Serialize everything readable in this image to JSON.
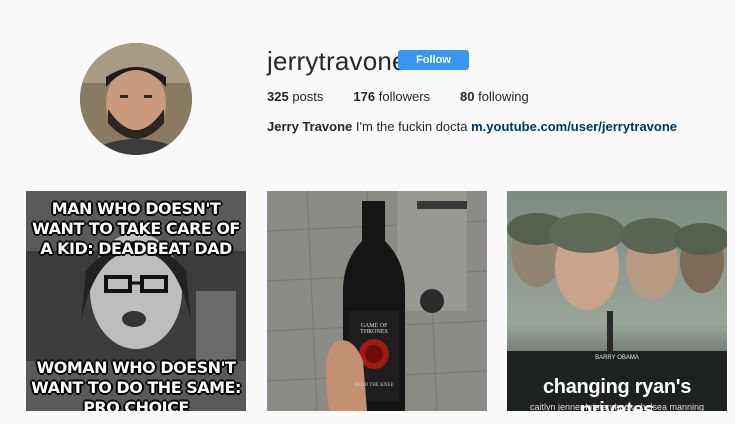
{
  "profile": {
    "username": "jerrytravone",
    "follow_label": "Follow",
    "stats": {
      "posts_count": "325",
      "posts_label": "posts",
      "followers_count": "176",
      "followers_label": "followers",
      "following_count": "80",
      "following_label": "following"
    },
    "bio": {
      "name": "Jerry Travone",
      "text": "I'm the fuckin docta",
      "link": "m.youtube.com/user/jerrytravone"
    }
  },
  "posts": [
    {
      "top_text": "MAN WHO DOESN'T WANT TO TAKE CARE OF A KID: DEADBEAT DAD",
      "bottom_text": "WOMAN WHO DOESN'T WANT TO DO THE SAME: PRO CHOICE"
    },
    {
      "bottle_label": "GAME OF THRONES",
      "bottle_sub": "BEND THE KNEE"
    },
    {
      "title": "changing ryan's privates",
      "credit": "BARRY OBAMA",
      "actors": "caitlyn jenner  kristen beck  chelsea manning"
    }
  ]
}
